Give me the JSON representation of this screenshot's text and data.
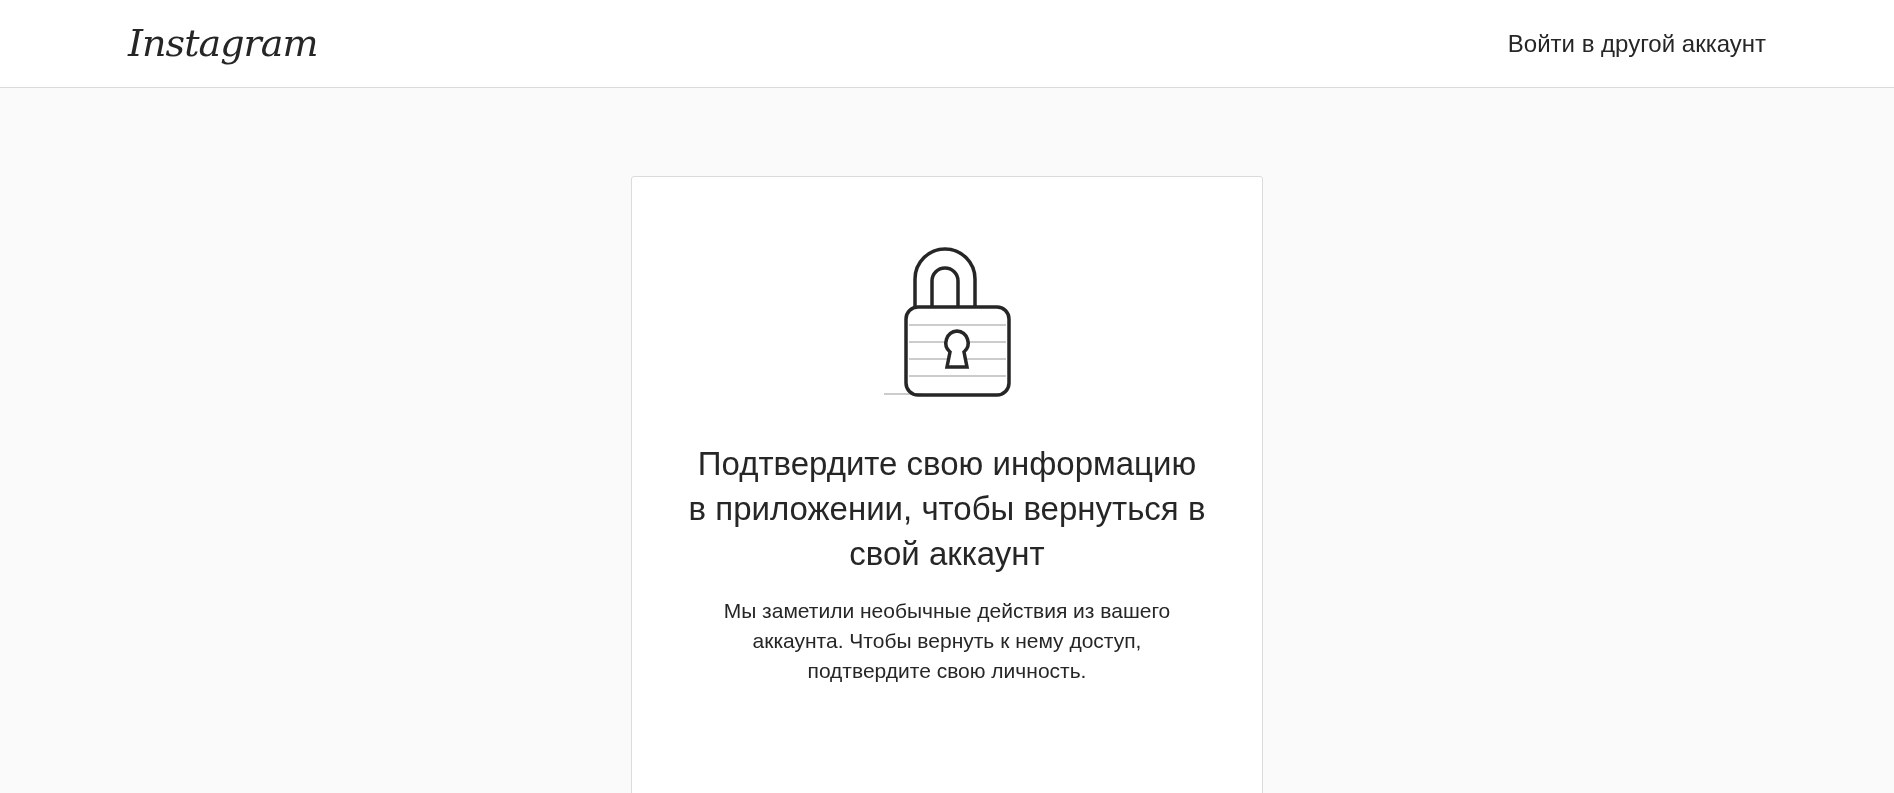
{
  "header": {
    "logo": "Instagram",
    "switch_account_link": "Войти в другой аккаунт"
  },
  "card": {
    "title": "Подтвердите свою информацию в приложении, чтобы вернуться в свой аккаунт",
    "description": "Мы заметили необычные действия из вашего аккаунта. Чтобы вернуть к нему доступ, подтвердите свою личность."
  }
}
